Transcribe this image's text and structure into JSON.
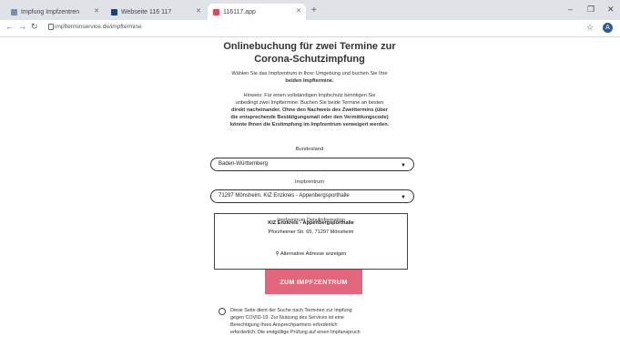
{
  "browser": {
    "tabs": [
      {
        "label": "Impfung Impfzentren"
      },
      {
        "label": "Webseite 116 117"
      },
      {
        "label": "116117.app",
        "active": true
      }
    ],
    "url": "impfterminservice.de/impftermine",
    "profile_initial": "A"
  },
  "page": {
    "title_line1": "Onlinebuchung für zwei Termine zur",
    "title_line2": "Corona-Schutzimpfung",
    "intro_lines": [
      "Wählen Sie das Impfzentrum in Ihrer Umgebung und buchen Sie Ihre",
      "beiden Impftermine."
    ],
    "hint_lines": [
      "Hinweis: Für einen vollständigen Impfschutz benötigen Sie",
      "unbedingt zwei Impftermine. Buchen Sie beide Termine an besten",
      "direkt nacheinander. Ohne den Nachweis des Zweittermins (über",
      "die entsprechende Bestätigungsmail oder den Vermittlungscode)",
      "könnte Ihnen die Erstimpfung im Impfzentrum verweigert werden."
    ],
    "state_label": "Bundesland",
    "state_value": "Baden-Württemberg",
    "center_label": "Impfzentrum",
    "center_value": "71297 Mönsheim, KIZ Enzkreis - Appenbergsporthalle",
    "info": {
      "legend": "Impfzentrum Detailinformation",
      "name": "KIZ Enzkreis - Appenbergsporthalle",
      "address": "Pforzheimer Str. 65, 71297 Mönsheim",
      "map_link": "Alternative Adresse anzeigen"
    },
    "cta_label": "ZUM IMPFZENTRUM",
    "disclaimer_lines": [
      "Diese Seite dient der Suche nach Terminen zur Impfung",
      "gegen COVID-19. Zur Nutzung des Services ist eine",
      "Berechtigung Ihres Ansprechpartners erforderlich",
      "erforderlich. Die endgültige Prüfung auf einen Impfanspruch"
    ]
  },
  "colors": {
    "accent": "#e2667c",
    "tabbar": "#dfe3e8"
  }
}
